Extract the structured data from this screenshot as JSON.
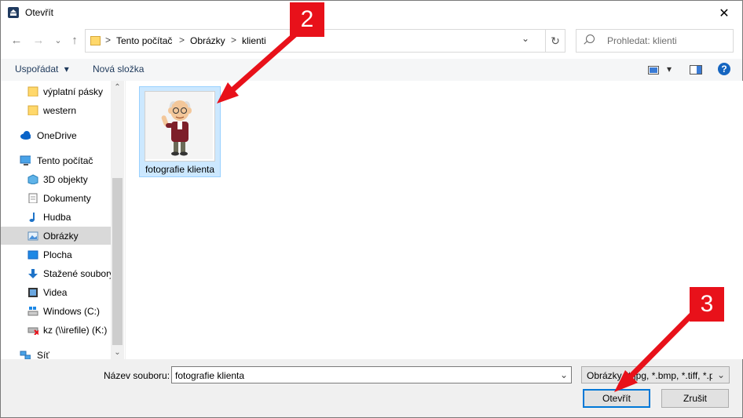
{
  "window": {
    "title": "Otevřít",
    "close_glyph": "✕"
  },
  "nav": {
    "back_glyph": "←",
    "forward_glyph": "→",
    "recent_glyph": "⌄",
    "up_glyph": "↑",
    "breadcrumbs": [
      "Tento počítač",
      "Obrázky",
      "klienti"
    ],
    "separator": ">",
    "dropdown_glyph": "⌄",
    "refresh_glyph": "↻",
    "search_placeholder": "Prohledat: klienti"
  },
  "toolbar": {
    "organize_label": "Uspořádat",
    "organize_caret": "▾",
    "new_folder_label": "Nová složka",
    "view_caret": "▾",
    "help_label": "?"
  },
  "sidebar": {
    "items": [
      {
        "label": "výplatní pásky",
        "icon": "folder-icon"
      },
      {
        "label": "western",
        "icon": "folder-icon"
      },
      {
        "label": "OneDrive",
        "icon": "cloud-icon"
      },
      {
        "label": "Tento počítač",
        "icon": "computer-icon"
      },
      {
        "label": "3D objekty",
        "icon": "cube-icon"
      },
      {
        "label": "Dokumenty",
        "icon": "document-icon"
      },
      {
        "label": "Hudba",
        "icon": "music-icon"
      },
      {
        "label": "Obrázky",
        "icon": "pictures-icon",
        "selected": true
      },
      {
        "label": "Plocha",
        "icon": "desktop-icon"
      },
      {
        "label": "Stažené soubory",
        "icon": "download-icon"
      },
      {
        "label": "Videa",
        "icon": "video-icon"
      },
      {
        "label": "Windows  (C:)",
        "icon": "drive-icon"
      },
      {
        "label": "kz (\\\\irefile) (K:)",
        "icon": "network-drive-disconnected-icon"
      },
      {
        "label": "Síť",
        "icon": "network-icon"
      }
    ],
    "scroll_up_glyph": "⌃",
    "scroll_down_glyph": "⌄"
  },
  "files": [
    {
      "name": "fotografie klienta",
      "selected": true
    }
  ],
  "bottom": {
    "filename_label": "Název souboru:",
    "filename_value": "fotografie klienta",
    "filename_dropdown_glyph": "⌄",
    "filter_value": "Obrázky (*.jpg, *.bmp, *.tiff, *.p",
    "filter_dropdown_glyph": "⌄",
    "open_label": "Otevřít",
    "cancel_label": "Zrušit"
  },
  "annotations": [
    {
      "label": "2",
      "color": "#e8111a"
    },
    {
      "label": "3",
      "color": "#e8111a"
    }
  ]
}
